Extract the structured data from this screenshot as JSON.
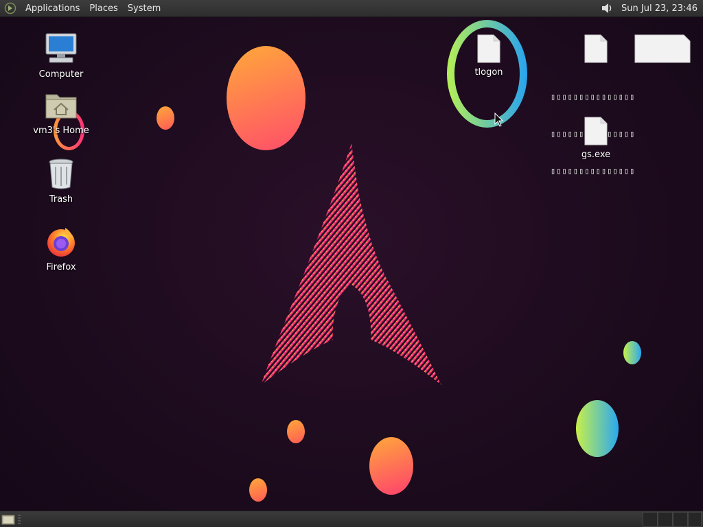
{
  "top_panel": {
    "menus": [
      "Applications",
      "Places",
      "System"
    ],
    "clock": "Sun Jul 23, 23:46",
    "volume_icon": "speaker-icon"
  },
  "desktop_icons_left": [
    {
      "label": "Computer",
      "icon": "computer-icon"
    },
    {
      "label": "vm3's Home",
      "icon": "home-folder-icon"
    },
    {
      "label": "Trash",
      "icon": "trash-icon"
    },
    {
      "label": "Firefox",
      "icon": "firefox-icon"
    }
  ],
  "desktop_icons_right": [
    {
      "label": "tlogon",
      "icon": "file-icon"
    },
    {
      "label": "gs.exe",
      "icon": "file-icon"
    }
  ],
  "garbled_filename": {
    "line1": "▯▯▯▯▯▯▯▯▯▯▯▯▯▯▯",
    "line2": "▯▯▯▯▯▯▯▯▯▯▯▯▯▯▯",
    "line3": "▯▯▯▯▯▯▯▯▯▯▯▯▯▯▯"
  },
  "colors": {
    "background": "#1d0b1e",
    "accent_pink": "#e0106a",
    "accent_orange": "#ff9a3c",
    "panel": "#333333"
  }
}
